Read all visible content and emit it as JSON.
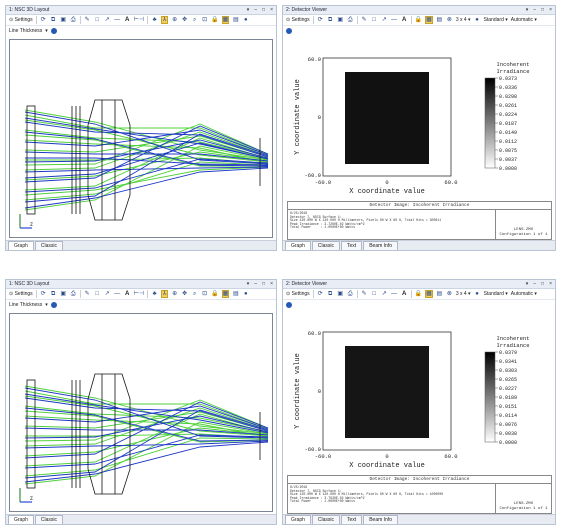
{
  "windows": [
    {
      "layout": {
        "title": "1: NSC 3D Layout",
        "settings_label": "Settings",
        "line_thickness_label": "Line Thickness",
        "tabs": [
          "Graph",
          "Classic"
        ]
      },
      "detector": {
        "title": "2: Detector Viewer",
        "settings_label": "Settings",
        "grid_label": "3 x 4",
        "standard_label": "Standard",
        "automatic_label": "Automatic",
        "tabs": [
          "Graph",
          "Classic",
          "Text",
          "Beam Info"
        ],
        "y_axis_label": "Y coordinate value",
        "x_axis_label": "X coordinate value",
        "y_ticks": [
          "60.0",
          "0",
          "-60.0"
        ],
        "x_ticks": [
          "-60.0",
          "0",
          "60.0"
        ],
        "legend_title_line1": "Incoherent",
        "legend_title_line2": "Irradiance",
        "legend_values": [
          "0.0373",
          "0.0336",
          "0.0298",
          "0.0261",
          "0.0224",
          "0.0187",
          "0.0149",
          "0.0112",
          "0.0075",
          "0.0037",
          "0.0000"
        ],
        "info_title": "Detector Image: Incoherent Irradiance",
        "info_lines": [
          "8/25/2016",
          "Detector 7, NSCG Surface 1:",
          "Size 120.000 W X 120.000 H Millimeters, Pixels 80 W X 80 H, Total Hits = 300611",
          "Peak Irradiance : 3.7260E-02 Watts/cm^2",
          "Total Power     : 1.0000E+00 Watts"
        ],
        "info_file": "LENS.ZMX",
        "info_config": "Configuration 1 of 1"
      }
    },
    {
      "layout": {
        "title": "1: NSC 3D Layout",
        "settings_label": "Settings",
        "line_thickness_label": "Line Thickness",
        "tabs": [
          "Graph",
          "Classic"
        ]
      },
      "detector": {
        "title": "2: Detector Viewer",
        "settings_label": "Settings",
        "grid_label": "3 x 4",
        "standard_label": "Standard",
        "automatic_label": "Automatic",
        "tabs": [
          "Graph",
          "Classic",
          "Text",
          "Beam Info"
        ],
        "y_axis_label": "Y coordinate value",
        "x_axis_label": "X coordinate value",
        "y_ticks": [
          "60.0",
          "0",
          "-60.0"
        ],
        "x_ticks": [
          "-60.0",
          "0",
          "60.0"
        ],
        "legend_title_line1": "Incoherent",
        "legend_title_line2": "Irradiance",
        "legend_values": [
          "0.0379",
          "0.0341",
          "0.0303",
          "0.0265",
          "0.0227",
          "0.0189",
          "0.0151",
          "0.0114",
          "0.0076",
          "0.0038",
          "0.0000"
        ],
        "info_title": "Detector Image: Incoherent Irradiance",
        "info_lines": [
          "8/25/2016",
          "Detector 7, NSCG Surface 1:",
          "Size 120.000 W X 120.000 H Millimeters, Pixels 80 W X 80 H, Total Hits = 1000000",
          "Peak Irradiance : 3.7930E-02 Watts/cm^2",
          "Total Power     : 1.0000E+00 Watts"
        ],
        "info_file": "LENS.ZMX",
        "info_config": "Configuration 1 of 1"
      }
    }
  ],
  "colors": {
    "ray_blue": "#1f37c8",
    "ray_green": "#4fd13a",
    "highlight": "#f2cf5a"
  }
}
